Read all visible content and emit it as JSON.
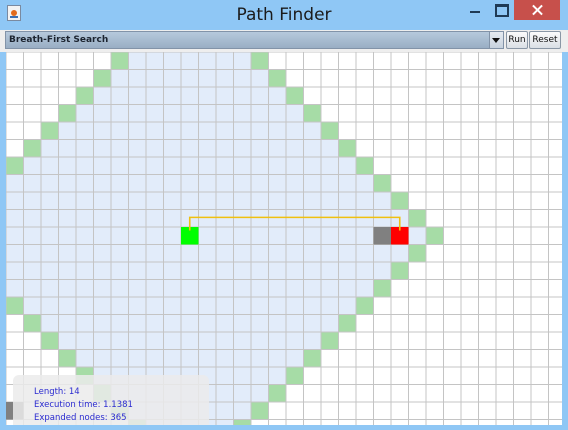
{
  "window": {
    "title": "Path Finder"
  },
  "toolbar": {
    "algorithm": "Breath-First Search",
    "run_label": "Run",
    "reset_label": "Reset"
  },
  "stats": {
    "length": "Length: 14",
    "execution_time": "Execution time: 1.1381",
    "expanded_nodes": "Expanded nodes: 365"
  },
  "colors": {
    "explored": "#e2ecfa",
    "frontier": "#a6dca6",
    "start": "#00ff00",
    "goal": "#ff0000",
    "wall": "#808080",
    "path": "#f0c010",
    "grid_line": "#c4c4c4"
  }
}
